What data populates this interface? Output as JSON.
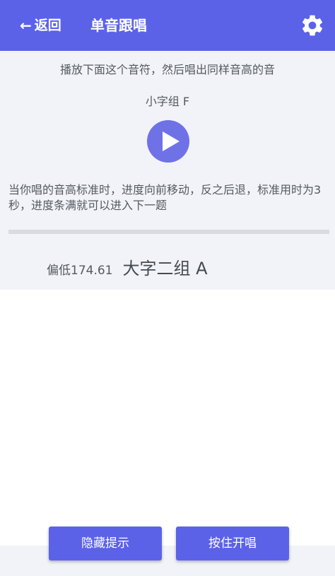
{
  "header": {
    "back_arrow": "←",
    "back_label": "返回",
    "title": "单音跟唱",
    "settings_icon": "gear-icon"
  },
  "exercise": {
    "instruction": "播放下面这个音符，然后唱出同样音高的音",
    "target_note": "小字组 F",
    "play_icon": "play-icon",
    "description": "当你唱的音高标准时，进度向前移动，反之后退，标准用时为3秒，进度条满就可以进入下一题",
    "progress_fraction": 0
  },
  "pitch_reading": {
    "status": "偏低174.61",
    "detected_note": "大字二组 A"
  },
  "actions": {
    "hide_hint_label": "隐藏提示",
    "hold_to_sing_label": "按住开唱"
  },
  "colors": {
    "accent": "#5b62e8",
    "play_button": "#6f72e6",
    "panel_background": "#f1f3f9",
    "text": "#555a5f"
  }
}
